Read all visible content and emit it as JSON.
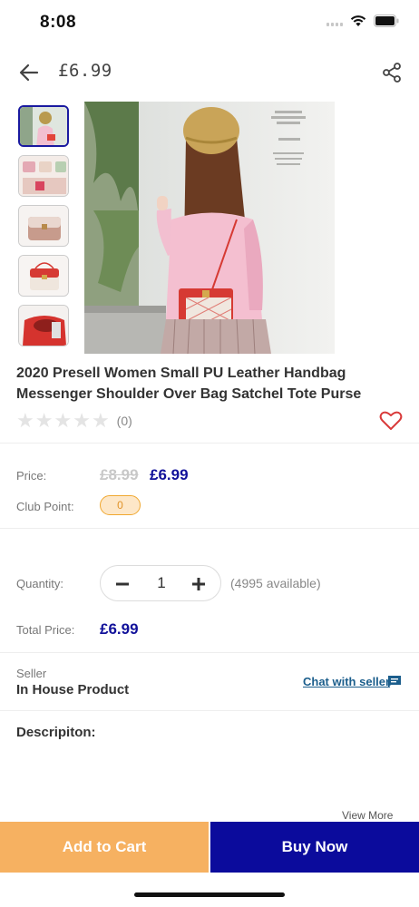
{
  "status_bar": {
    "time": "8:08"
  },
  "header": {
    "title": "£6.99",
    "icons": {
      "back": "back-arrow-icon",
      "share": "share-icon"
    }
  },
  "gallery": {
    "thumbnail_count": 5,
    "selected_index": 0
  },
  "product": {
    "title": "2020 Presell  Women Small PU Leather Handbag Messenger Shoulder Over Bag Satchel Tote Purse",
    "rating": 0,
    "review_count": "(0)"
  },
  "pricing": {
    "price_label": "Price:",
    "old_price": "£8.99",
    "new_price": "£6.99",
    "club_point_label": "Club Point:",
    "club_point_value": "0"
  },
  "purchase": {
    "quantity_label": "Quantity:",
    "quantity_value": "1",
    "available_text": "(4995 available)",
    "total_label": "Total Price:",
    "total_value": "£6.99"
  },
  "seller": {
    "label": "Seller",
    "name": "In House Product",
    "chat_label": "Chat with seller"
  },
  "description": {
    "title": "Descripiton:",
    "view_more": "View More"
  },
  "actions": {
    "add_to_cart": "Add to Cart",
    "buy_now": "Buy Now"
  },
  "colors": {
    "accent_blue": "#0b0b9c",
    "accent_orange": "#f6b161",
    "price_blue": "#11119a",
    "wishlist_red": "#d93a3a"
  }
}
